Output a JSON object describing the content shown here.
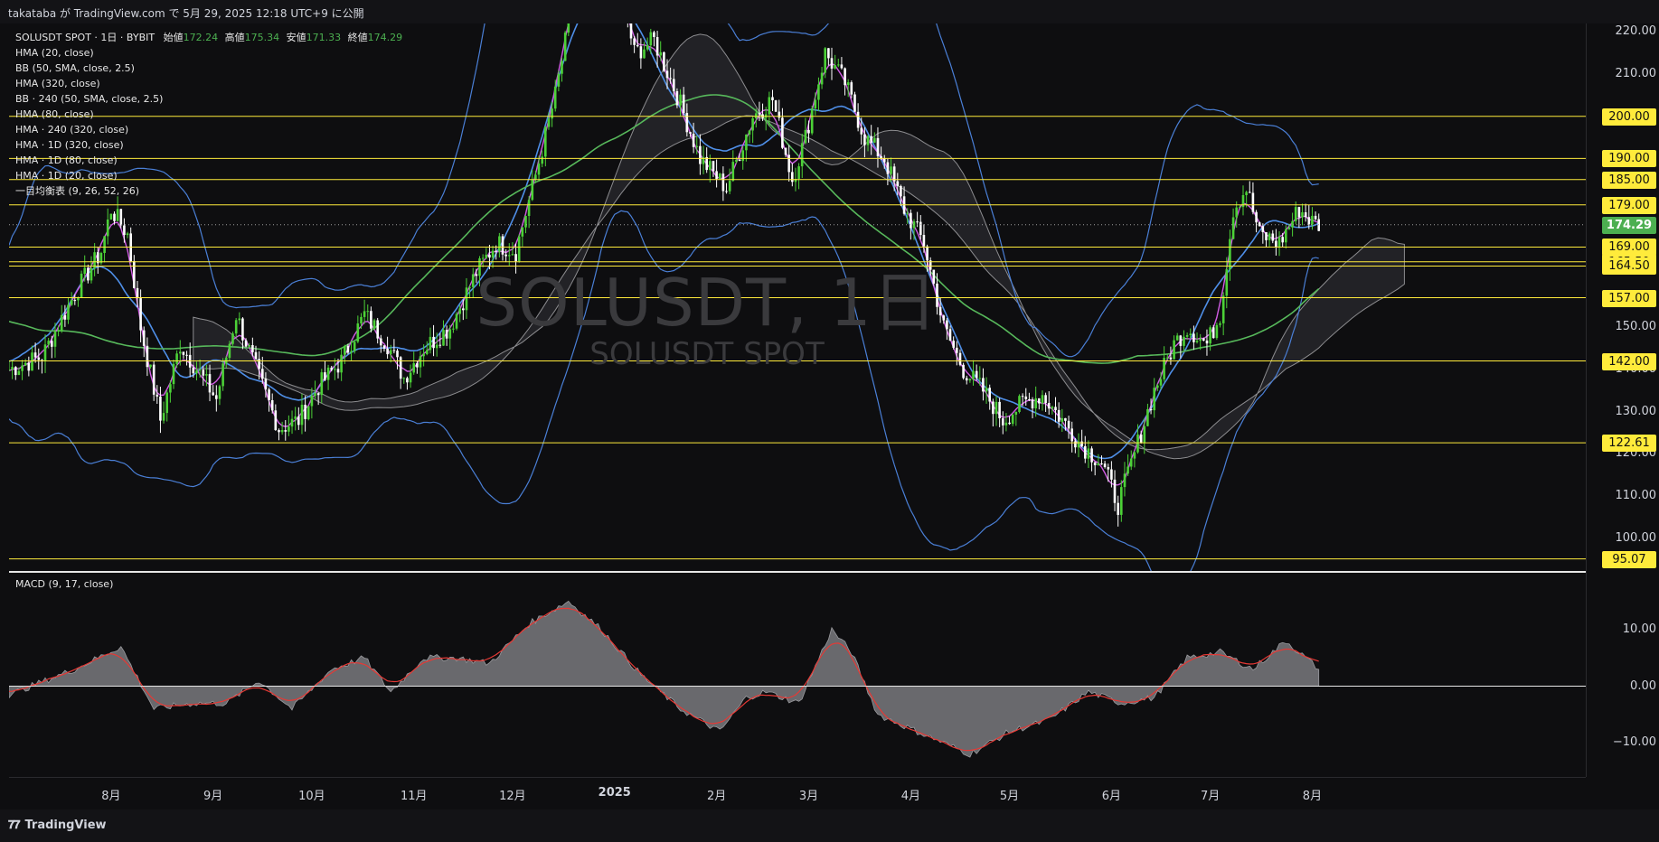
{
  "header": {
    "publish_line": "takataba が TradingView.com で 5月 29, 2025 12:18 UTC+9 に公開"
  },
  "legend": {
    "symbol_line": "SOLUSDT SPOT · 1日 · BYBIT",
    "ohlc": [
      {
        "label": "始値",
        "value": "172.24"
      },
      {
        "label": "高値",
        "value": "175.34"
      },
      {
        "label": "安値",
        "value": "171.33"
      },
      {
        "label": "終値",
        "value": "174.29"
      }
    ],
    "indicators": [
      "HMA (20, close)",
      "BB (50, SMA, close, 2.5)",
      "HMA (320, close)",
      "BB · 240 (50, SMA, close, 2.5)",
      "HMA (80, close)",
      "HMA · 240 (320, close)",
      "HMA · 1D (320, close)",
      "HMA · 1D (80, close)",
      "HMA · 1D (20, close)",
      "一目均衡表 (9, 26, 52, 26)"
    ]
  },
  "watermark": {
    "main": "SOLUSDT, 1日",
    "sub": "SOLUSDT SPOT"
  },
  "price_axis": {
    "ticks": [
      "220.00",
      "210.00",
      "150.00",
      "140.00",
      "130.00",
      "120.00",
      "110.00",
      "100.00"
    ],
    "tick_values": [
      220,
      210,
      150,
      140,
      130,
      120,
      110,
      100
    ],
    "levels": [
      "200.00",
      "190.00",
      "185.00",
      "179.00",
      "169.00",
      "165.50",
      "164.50",
      "157.00",
      "142.00",
      "122.61",
      "95.07"
    ],
    "level_values": [
      200,
      190,
      185,
      179,
      169,
      165.5,
      164.5,
      157,
      142,
      122.61,
      95.07
    ],
    "current_price": "174.29",
    "current_value": 174.29
  },
  "macd": {
    "label": "MACD (9, 17, close)",
    "ticks": [
      "10.00",
      "0.00",
      "−10.00"
    ],
    "tick_values": [
      10,
      0,
      -10
    ]
  },
  "time_axis": {
    "labels": [
      "8月",
      "9月",
      "10月",
      "11月",
      "12月",
      "2025",
      "2月",
      "3月",
      "4月",
      "5月",
      "6月",
      "7月",
      "8月"
    ],
    "bold_index": 5
  },
  "footer": {
    "brand": "TradingView"
  },
  "colors": {
    "level_line": "#ffeb3b",
    "current": "#4caf50",
    "bull": "#4cd137",
    "bear": "#ffffff",
    "hma20": "#d05ce3",
    "bb": "#4a7fd6",
    "hma320": "#57b85b",
    "macd_signal": "#e53935",
    "macd_hist": "#6f6f73"
  },
  "chart_data": {
    "type": "candlestick",
    "symbol": "SOLUSDT SPOT",
    "timeframe": "1日",
    "x_range": [
      "2024-07-01",
      "2025-08-15"
    ],
    "ylim": [
      92,
      222
    ],
    "close_path": [
      [
        0,
        140
      ],
      [
        10,
        143
      ],
      [
        20,
        158
      ],
      [
        28,
        168
      ],
      [
        31,
        178
      ],
      [
        36,
        172
      ],
      [
        40,
        150
      ],
      [
        46,
        128
      ],
      [
        52,
        146
      ],
      [
        58,
        139
      ],
      [
        63,
        133
      ],
      [
        69,
        153
      ],
      [
        76,
        138
      ],
      [
        82,
        126
      ],
      [
        88,
        128
      ],
      [
        94,
        136
      ],
      [
        101,
        142
      ],
      [
        108,
        153
      ],
      [
        115,
        146
      ],
      [
        120,
        138
      ],
      [
        126,
        145
      ],
      [
        134,
        150
      ],
      [
        142,
        163
      ],
      [
        148,
        170
      ],
      [
        154,
        168
      ],
      [
        160,
        186
      ],
      [
        166,
        205
      ],
      [
        172,
        230
      ],
      [
        180,
        238
      ],
      [
        186,
        230
      ],
      [
        190,
        215
      ],
      [
        196,
        218
      ],
      [
        203,
        205
      ],
      [
        210,
        190
      ],
      [
        218,
        183
      ],
      [
        226,
        200
      ],
      [
        232,
        204
      ],
      [
        238,
        185
      ],
      [
        242,
        195
      ],
      [
        248,
        215
      ],
      [
        254,
        208
      ],
      [
        260,
        195
      ],
      [
        266,
        190
      ],
      [
        272,
        178
      ],
      [
        278,
        170
      ],
      [
        284,
        150
      ],
      [
        290,
        140
      ],
      [
        296,
        135
      ],
      [
        302,
        128
      ],
      [
        308,
        132
      ],
      [
        314,
        134
      ],
      [
        320,
        128
      ],
      [
        326,
        122
      ],
      [
        332,
        118
      ],
      [
        337,
        108
      ],
      [
        342,
        120
      ],
      [
        348,
        135
      ],
      [
        354,
        146
      ],
      [
        358,
        150
      ],
      [
        364,
        146
      ],
      [
        368,
        153
      ],
      [
        372,
        178
      ],
      [
        376,
        183
      ],
      [
        380,
        172
      ],
      [
        386,
        170
      ],
      [
        392,
        178
      ],
      [
        396,
        175
      ],
      [
        398,
        174.29
      ]
    ],
    "macd_path": [
      [
        0,
        -1.5
      ],
      [
        20,
        3
      ],
      [
        34,
        7
      ],
      [
        44,
        -4
      ],
      [
        56,
        -3
      ],
      [
        66,
        -3
      ],
      [
        76,
        1
      ],
      [
        86,
        -4
      ],
      [
        98,
        3
      ],
      [
        108,
        5
      ],
      [
        116,
        -1
      ],
      [
        126,
        5
      ],
      [
        136,
        5
      ],
      [
        146,
        4
      ],
      [
        158,
        11
      ],
      [
        170,
        15
      ],
      [
        180,
        10
      ],
      [
        192,
        2
      ],
      [
        204,
        -4
      ],
      [
        216,
        -8
      ],
      [
        224,
        -2
      ],
      [
        230,
        -1
      ],
      [
        240,
        -3
      ],
      [
        250,
        10
      ],
      [
        256,
        6
      ],
      [
        264,
        -5
      ],
      [
        276,
        -8
      ],
      [
        292,
        -12
      ],
      [
        304,
        -8
      ],
      [
        316,
        -6
      ],
      [
        328,
        -1
      ],
      [
        338,
        -3
      ],
      [
        348,
        -2
      ],
      [
        358,
        5
      ],
      [
        368,
        6
      ],
      [
        378,
        3
      ],
      [
        388,
        8
      ],
      [
        398,
        3
      ]
    ],
    "day_index_origin": "2024-07-01"
  }
}
